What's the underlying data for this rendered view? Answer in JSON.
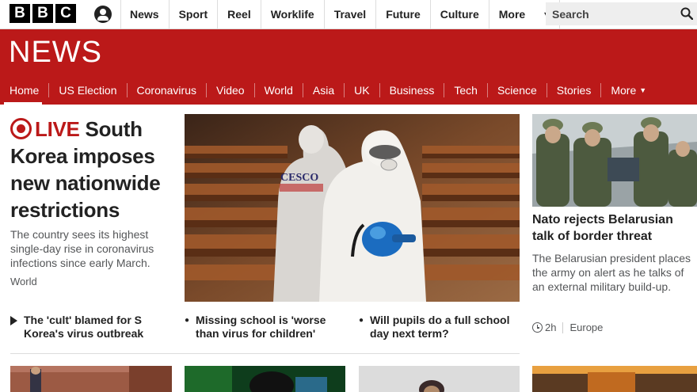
{
  "brand": {
    "letters": [
      "B",
      "B",
      "C"
    ],
    "section_title": "NEWS"
  },
  "top_nav": [
    {
      "label": "News"
    },
    {
      "label": "Sport"
    },
    {
      "label": "Reel"
    },
    {
      "label": "Worklife"
    },
    {
      "label": "Travel"
    },
    {
      "label": "Future"
    },
    {
      "label": "Culture"
    },
    {
      "label": "More"
    }
  ],
  "search": {
    "placeholder": "Search"
  },
  "sub_nav": {
    "items": [
      {
        "label": "Home",
        "active": true
      },
      {
        "label": "US Election"
      },
      {
        "label": "Coronavirus"
      },
      {
        "label": "Video"
      },
      {
        "label": "World"
      },
      {
        "label": "Asia"
      },
      {
        "label": "UK"
      },
      {
        "label": "Business"
      },
      {
        "label": "Tech"
      },
      {
        "label": "Science"
      },
      {
        "label": "Stories"
      }
    ],
    "more_label": "More"
  },
  "lead": {
    "live_label": "LIVE",
    "headline": "South Korea imposes new nationwide restrictions",
    "summary": "The country sees its highest single-day rise in coronavirus infections since early March.",
    "tag": "World",
    "image_overlay_text": "CESCO"
  },
  "related": [
    {
      "text": "The 'cult' blamed for S Korea's virus outbreak",
      "icon": "play-icon"
    },
    {
      "text": "Missing school is 'worse than virus for children'",
      "icon": "bullet"
    },
    {
      "text": "Will pupils do a full school day next term?",
      "icon": "bullet"
    }
  ],
  "side_story": {
    "headline": "Nato rejects Belarusian talk of border threat",
    "summary": "The Belarusian president places the army on alert as he talks of an external military build-up.",
    "time": "2h",
    "tag": "Europe"
  },
  "colors": {
    "brand_red": "#bb1919",
    "text": "#222222",
    "muted": "#545658"
  }
}
